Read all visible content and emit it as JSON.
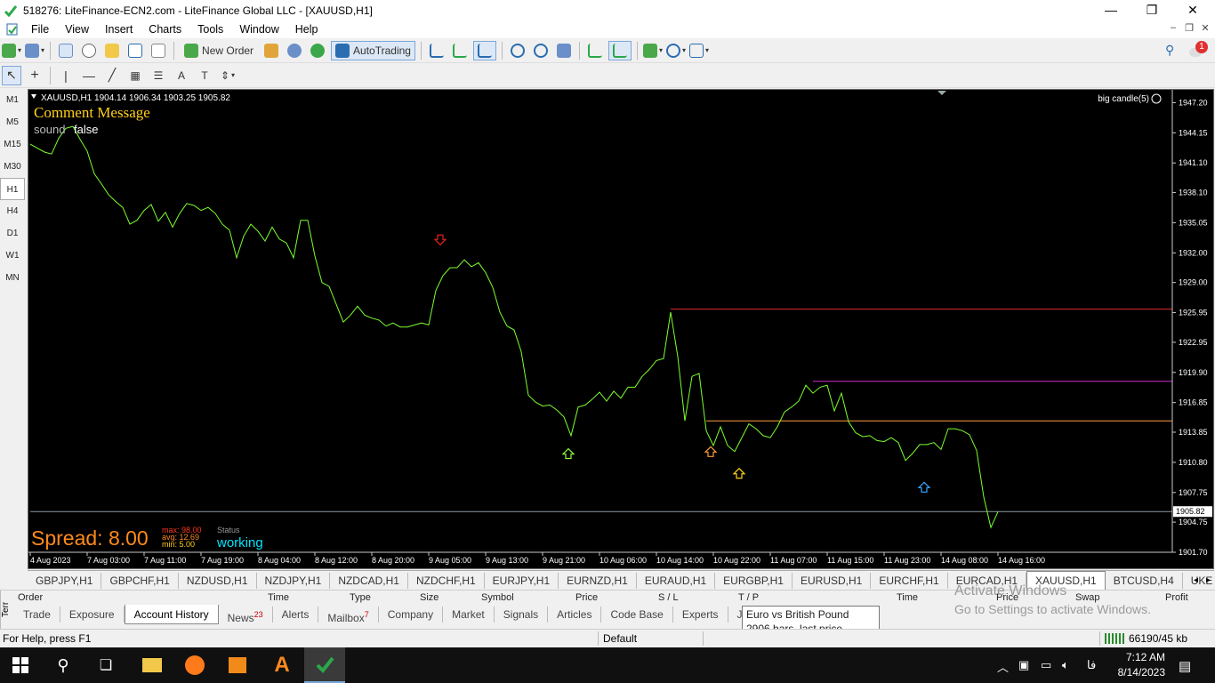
{
  "window": {
    "title": "518276: LiteFinance-ECN2.com - LiteFinance Global LLC - [XAUUSD,H1]",
    "minimize": "—",
    "maximize": "❐",
    "close": "✕"
  },
  "menu": [
    "File",
    "View",
    "Insert",
    "Charts",
    "Tools",
    "Window",
    "Help"
  ],
  "toolbar": {
    "new_order_label": "New Order",
    "autotrading_label": "AutoTrading",
    "notification_count": "1"
  },
  "periods": [
    "M1",
    "M5",
    "M15",
    "M30",
    "H1",
    "H4",
    "D1",
    "W1",
    "MN"
  ],
  "active_period": "H1",
  "chart": {
    "header": "XAUUSD,H1  1904.14 1906.34 1903.25 1905.82",
    "indicator_label": "big candle(5)",
    "comment_title": "Comment Message",
    "sound_label": "sound",
    "sound_value": "false",
    "spread_label": "Spread: 8.00",
    "stats_max": "max: 98.00",
    "stats_avg": "avg: 12.69",
    "stats_min": "min: 5.00",
    "status_label": "Status",
    "status_value": "working",
    "current_price": "1905.82",
    "colors": {
      "background": "#000000",
      "line": "#7cff2e",
      "comment": "#ffd11a",
      "spread": "#ff8a1c",
      "status": "#00e5ff",
      "resistance_red": "#e52a2a",
      "resistance_magenta": "#d42cd4",
      "support_orange": "#ff9c3c"
    }
  },
  "chart_data": {
    "type": "line",
    "symbol": "XAUUSD",
    "timeframe": "H1",
    "y_ticks": [
      "1947.20",
      "1944.15",
      "1941.10",
      "1938.10",
      "1935.05",
      "1932.00",
      "1929.00",
      "1925.95",
      "1922.95",
      "1919.90",
      "1916.85",
      "1913.85",
      "1910.80",
      "1907.75",
      "1904.75",
      "1901.70"
    ],
    "ylim": [
      1901.7,
      1948.5
    ],
    "x_ticks": [
      "4 Aug 2023",
      "7 Aug 03:00",
      "7 Aug 11:00",
      "7 Aug 19:00",
      "8 Aug 04:00",
      "8 Aug 12:00",
      "8 Aug 20:00",
      "9 Aug 05:00",
      "9 Aug 13:00",
      "9 Aug 21:00",
      "10 Aug 06:00",
      "10 Aug 14:00",
      "10 Aug 22:00",
      "11 Aug 07:00",
      "11 Aug 15:00",
      "11 Aug 23:00",
      "14 Aug 08:00",
      "14 Aug 16:00"
    ],
    "close_series": [
      1943.0,
      1942.6,
      1942.2,
      1942.0,
      1943.6,
      1944.6,
      1944.8,
      1943.5,
      1942.3,
      1940.0,
      1939.0,
      1937.9,
      1937.2,
      1936.6,
      1934.9,
      1935.3,
      1936.3,
      1936.9,
      1935.2,
      1936.1,
      1934.6,
      1936.0,
      1937.0,
      1936.8,
      1936.3,
      1936.6,
      1936.0,
      1934.9,
      1934.3,
      1931.5,
      1933.7,
      1934.9,
      1934.2,
      1933.2,
      1934.6,
      1933.4,
      1933.0,
      1931.5,
      1935.3,
      1935.3,
      1931.7,
      1929.0,
      1928.6,
      1926.8,
      1925.0,
      1925.7,
      1926.6,
      1925.7,
      1925.4,
      1925.2,
      1924.6,
      1924.9,
      1924.5,
      1924.5,
      1924.7,
      1924.9,
      1924.7,
      1928.2,
      1929.7,
      1930.5,
      1930.5,
      1931.3,
      1930.6,
      1931.0,
      1930.0,
      1928.5,
      1926.0,
      1924.6,
      1924.2,
      1922.0,
      1917.6,
      1916.9,
      1916.5,
      1916.6,
      1916.1,
      1915.4,
      1913.5,
      1916.4,
      1916.6,
      1917.2,
      1917.9,
      1917.0,
      1918.0,
      1917.3,
      1918.4,
      1918.4,
      1919.5,
      1920.2,
      1921.1,
      1921.3,
      1926.0,
      1921.5,
      1915.0,
      1919.5,
      1919.8,
      1914.0,
      1912.5,
      1914.4,
      1912.5,
      1911.9,
      1913.3,
      1914.7,
      1914.2,
      1913.5,
      1913.3,
      1914.4,
      1915.9,
      1916.4,
      1917.0,
      1918.6,
      1917.8,
      1918.4,
      1918.6,
      1916.0,
      1917.8,
      1914.9,
      1913.8,
      1913.4,
      1913.5,
      1913.0,
      1912.9,
      1913.3,
      1912.8,
      1911.0,
      1911.7,
      1912.6,
      1912.6,
      1912.8,
      1912.1,
      1914.2,
      1914.2,
      1914.0,
      1913.6,
      1912.0,
      1907.3,
      1904.2,
      1905.8
    ],
    "horizontal_levels": [
      {
        "name": "red-level",
        "value": 1926.3
      },
      {
        "name": "magenta-level",
        "value": 1919.0
      },
      {
        "name": "orange-level",
        "value": 1915.0
      },
      {
        "name": "bid-line",
        "value": 1905.82
      }
    ],
    "arrows": [
      {
        "type": "down",
        "color": "#e02020",
        "bar": 58,
        "value": 1933.0
      },
      {
        "type": "up",
        "color": "#8aff40",
        "bar": 76,
        "value": 1912.0
      },
      {
        "type": "up",
        "color": "#ff9c3c",
        "bar": 96,
        "value": 1912.2
      },
      {
        "type": "up",
        "color": "#ffd11a",
        "bar": 100,
        "value": 1910.0
      },
      {
        "type": "up",
        "color": "#3aa6ff",
        "bar": 126,
        "value": 1908.6
      }
    ]
  },
  "symbol_tabs": [
    "GBPJPY,H1",
    "GBPCHF,H1",
    "NZDUSD,H1",
    "NZDJPY,H1",
    "NZDCAD,H1",
    "NZDCHF,H1",
    "EURJPY,H1",
    "EURNZD,H1",
    "EURAUD,H1",
    "EURGBP,H1",
    "EURUSD,H1",
    "EURCHF,H1",
    "EURCAD,H1",
    "XAUUSD,H1",
    "BTCUSD,H4",
    "UKE"
  ],
  "active_symbol_tab": "XAUUSD,H1",
  "terminal": {
    "side_label": "Terr",
    "columns": [
      "Order",
      "Time",
      "Type",
      "Size",
      "Symbol",
      "Price",
      "S / L",
      "T / P",
      "Time",
      "Price",
      "Swap",
      "Profit"
    ],
    "tabs": [
      "Trade",
      "Exposure",
      "Account History",
      "News",
      "Alerts",
      "Mailbox",
      "Company",
      "Market",
      "Signals",
      "Articles",
      "Code Base",
      "Experts",
      "Journ"
    ],
    "news_count": "23",
    "mailbox_count": "7",
    "active_tab": "Account History"
  },
  "watermark": {
    "line1": "Activate Windows",
    "line2": "Go to Settings to activate Windows."
  },
  "tooltip": {
    "line1": "Euro vs British Pound",
    "line2": "2906 bars, last price 0.86102"
  },
  "status_bar": {
    "help": "For Help, press F1",
    "profile": "Default",
    "traffic": "66190/45 kb"
  },
  "taskbar": {
    "time": "7:12 AM",
    "date": "8/14/2023",
    "lang": "فا"
  }
}
